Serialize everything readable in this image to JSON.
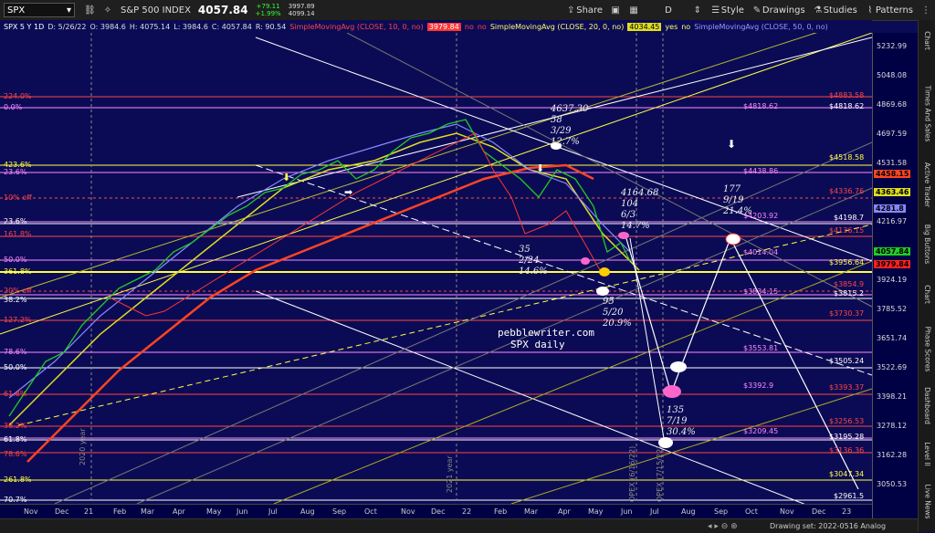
{
  "toolbar": {
    "symbol": "SPX",
    "symbol_dropdown": "▾",
    "index_name": "S&P 500 INDEX",
    "price": "4057.84",
    "change": "+79.11",
    "change_pct": "+1.99%",
    "high": "3997.89",
    "low": "4099.14",
    "share": "Share",
    "interval": "D",
    "style": "Style",
    "drawings": "Drawings",
    "studies": "Studies",
    "patterns": "Patterns"
  },
  "infobar": {
    "ticker": "SPX 5 Y 1D",
    "date": "D: 5/26/22",
    "open": "O: 3984.6",
    "high": "H: 4075.14",
    "low": "L: 3984.6",
    "close": "C: 4057.84",
    "r": "R: 90.54",
    "sma1": "SimpleMovingAvg (CLOSE, 10, 0, no)",
    "sma1_val": "3979.84",
    "sma1_yes": "no",
    "sma1_no": "no",
    "sma2": "SimpleMovingAvg (CLOSE, 20, 0, no)",
    "sma2_val": "4034.45",
    "sma2_yes": "yes",
    "sma2_no": "no",
    "sma3": "SimpleMovingAvg (CLOSE, 50, 0, no)"
  },
  "left_labels": [
    {
      "text": "224.0%",
      "color": "#ff4444"
    },
    {
      "text": "0.0%",
      "color": "#ff88ff"
    },
    {
      "text": "423.6%",
      "color": "#ffff44"
    },
    {
      "text": "23.6%",
      "color": "#ff88ff"
    },
    {
      "text": "10% off",
      "color": "#ff4444"
    },
    {
      "text": "23.6%",
      "color": "#ffffff"
    },
    {
      "text": "161.8%",
      "color": "#ff4444"
    },
    {
      "text": "50.0%",
      "color": "#ff88ff"
    },
    {
      "text": "361.8%",
      "color": "#ffff44"
    },
    {
      "text": "20% off",
      "color": "#ff4444"
    },
    {
      "text": "38.2%",
      "color": "#ffffff"
    },
    {
      "text": "127.2%",
      "color": "#ff4444"
    },
    {
      "text": "78.6%",
      "color": "#ff88ff"
    },
    {
      "text": "50.0%",
      "color": "#ffffff"
    },
    {
      "text": "61.8%",
      "color": "#ff4444"
    },
    {
      "text": "38.2%",
      "color": "#ff4444"
    },
    {
      "text": "61.8%",
      "color": "#ffffff"
    },
    {
      "text": "78.6%",
      "color": "#ff4444"
    },
    {
      "text": "261.8%",
      "color": "#ffff44"
    },
    {
      "text": "70.7%",
      "color": "#ffffff"
    }
  ],
  "right_level_labels": [
    {
      "text": "$4883.58",
      "color": "#ff4444"
    },
    {
      "text": "$4818.62",
      "color": "#ff88ff"
    },
    {
      "text": "$4818.62",
      "color": "#ffffff"
    },
    {
      "text": "$4518.58",
      "color": "#ffff44"
    },
    {
      "text": "$4438.86",
      "color": "#ff88ff"
    },
    {
      "text": "$4336.76",
      "color": "#ff4444"
    },
    {
      "text": "$4203.92",
      "color": "#ff88ff"
    },
    {
      "text": "$4198.7",
      "color": "#ffffff"
    },
    {
      "text": "$4136.15",
      "color": "#ff4444"
    },
    {
      "text": "$4014.04",
      "color": "#ff88ff"
    },
    {
      "text": "$3956.64",
      "color": "#ffff44"
    },
    {
      "text": "$3854.9",
      "color": "#ff4444"
    },
    {
      "text": "$3834.15",
      "color": "#ff88ff"
    },
    {
      "text": "$3815.2",
      "color": "#ffffff"
    },
    {
      "text": "$3730.37",
      "color": "#ff4444"
    },
    {
      "text": "$3553.81",
      "color": "#ff88ff"
    },
    {
      "text": "$3505.24",
      "color": "#ffffff"
    },
    {
      "text": "$3392.9",
      "color": "#ff88ff"
    },
    {
      "text": "$3393.37",
      "color": "#ff4444"
    },
    {
      "text": "$3256.53",
      "color": "#ff4444"
    },
    {
      "text": "$3209.45",
      "color": "#ff88ff"
    },
    {
      "text": "$3195.28",
      "color": "#ffffff"
    },
    {
      "text": "$3136.36",
      "color": "#ff4444"
    },
    {
      "text": "$3047.34",
      "color": "#ffff44"
    },
    {
      "text": "$2961.5",
      "color": "#ffffff"
    }
  ],
  "price_axis": [
    "5232.99",
    "5048.08",
    "4869.68",
    "4697.59",
    "4531.58",
    "4371.47",
    "4216.97",
    "4068.03",
    "3924.19",
    "3785.52",
    "3651.74",
    "3522.69",
    "3398.21",
    "3278.12",
    "3162.28",
    "3050.53"
  ],
  "axis_badges": [
    {
      "text": "4458.15",
      "bg": "#ff4422"
    },
    {
      "text": "4363.46",
      "bg": "#dddd22"
    },
    {
      "text": "4281.8",
      "bg": "#8888ff"
    },
    {
      "text": "4057.84",
      "bg": "#22cc22"
    },
    {
      "text": "3979.84",
      "bg": "#ff2222"
    }
  ],
  "x_axis": [
    "Nov",
    "Dec",
    "21",
    "Feb",
    "Mar",
    "Apr",
    "May",
    "Jun",
    "Jul",
    "Aug",
    "Sep",
    "Oct",
    "Nov",
    "Dec",
    "22",
    "Feb",
    "Mar",
    "Apr",
    "May",
    "Jun",
    "Jul",
    "Aug",
    "Sep",
    "Oct",
    "Nov",
    "Dec",
    "23"
  ],
  "watermark": {
    "line1": "pebblewriter.com",
    "line2": "SPX daily"
  },
  "annotations": [
    {
      "text": "4637.30\n58\n3/29\n12.7%"
    },
    {
      "text": "4164.68\n104\n6/3\n14.7%"
    },
    {
      "text": "177\n9/19\n21.4%"
    },
    {
      "text": "35\n2/24\n14.6%"
    },
    {
      "text": "95\n5/20\n20.9%"
    },
    {
      "text": "135\n7/19\n30.4%"
    }
  ],
  "vertical_labels": [
    "2020 year",
    "2021 year",
    "OPEX (6/16/22)",
    "OPEX (7/15/22)"
  ],
  "sidebar": [
    "Chart",
    "Times And Sales",
    "Active Trader",
    "Big Buttons",
    "Chart",
    "Phase Scores",
    "Dashboard",
    "Level II",
    "Live News"
  ],
  "status": "Drawing set: 2022-0516 Analog"
}
